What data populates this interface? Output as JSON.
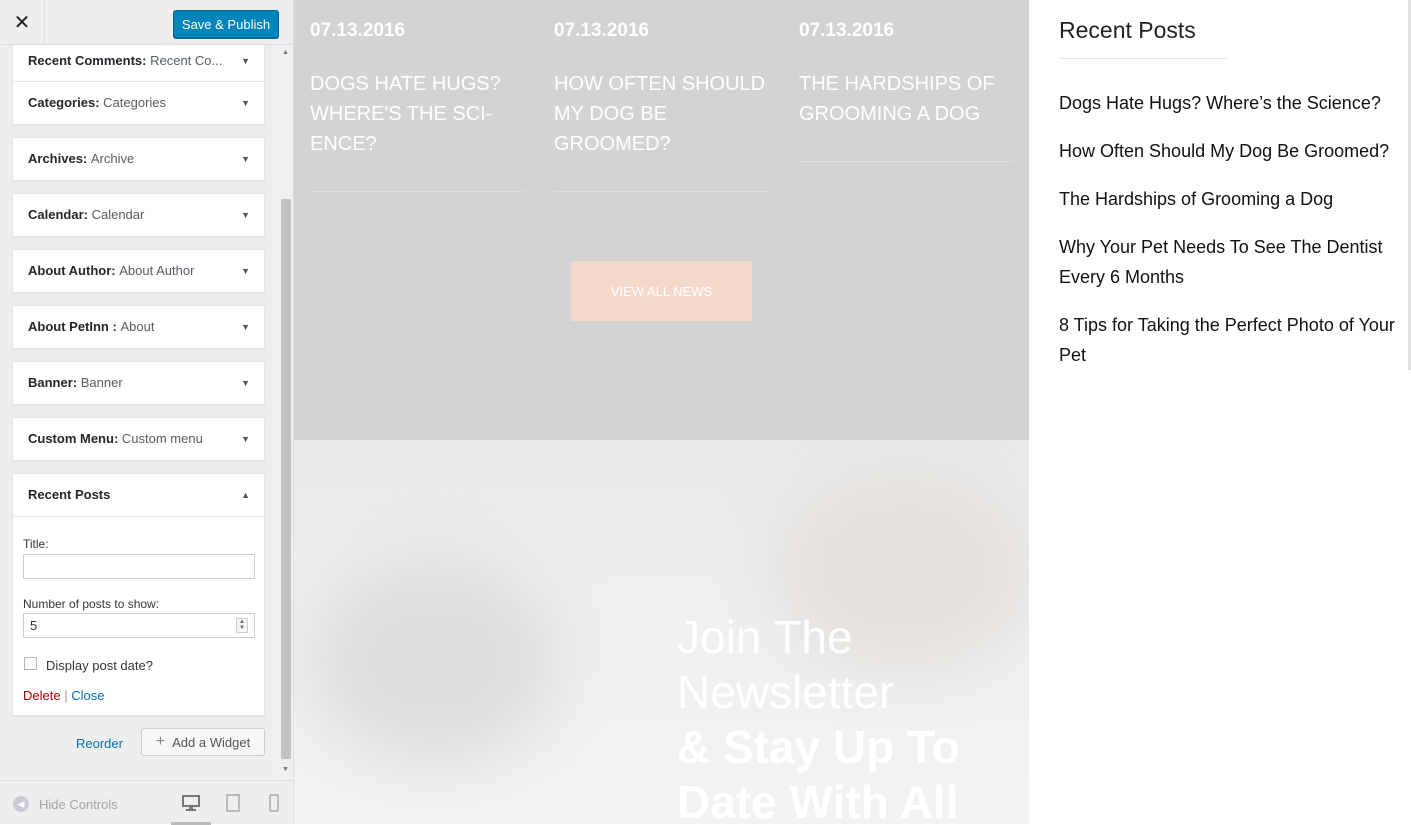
{
  "customizer": {
    "close_icon": "close-icon",
    "publish_label": "Save & Publish",
    "widgets": [
      {
        "name": "Recent Comments",
        "sub": "Recent Co..."
      },
      {
        "name": "Categories",
        "sub": "Categories"
      },
      {
        "name": "Archives",
        "sub": "Archive"
      },
      {
        "name": "Calendar",
        "sub": "Calendar"
      },
      {
        "name": "About Author",
        "sub": "About Author"
      },
      {
        "name": "About PetInn ",
        "sub": "About"
      },
      {
        "name": "Banner",
        "sub": "Banner"
      },
      {
        "name": "Custom Menu",
        "sub": "Custom menu"
      }
    ],
    "open_widget": {
      "name": "Recent Posts",
      "title_label": "Title:",
      "title_value": "",
      "number_label": "Number of posts to show:",
      "number_value": "5",
      "display_date_label": "Display post date?",
      "display_date_checked": false,
      "delete_label": "Delete",
      "separator": "|",
      "close_label": "Close"
    },
    "reorder_label": "Reorder",
    "add_widget_label": "Add a Widget",
    "hide_controls_label": "Hide Controls",
    "accent_color": "#0085ba"
  },
  "preview": {
    "news": [
      {
        "date": "07.13.2016",
        "title": "Dogs Hate Hugs? Where's the Sci- ence?"
      },
      {
        "date": "07.13.2016",
        "title": "How Often Should My Dog Be Groomed?"
      },
      {
        "date": "07.13.2016",
        "title": "The Hardships of Grooming a Dog"
      }
    ],
    "view_all_label": "View All News",
    "newsletter": {
      "line1": "Join The",
      "line2": "Newsletter",
      "line3": "& Stay Up To",
      "line4": "Date With All"
    },
    "button_color": "#f4d8ca"
  },
  "sidebar": {
    "title": "Recent Posts",
    "posts": [
      "Dogs Hate Hugs? Where’s the Science?",
      "How Often Should My Dog Be Groomed?",
      "The Hardships of Grooming a Dog",
      "Why Your Pet Needs To See The Dentist Every 6 Months",
      "8 Tips for Taking the Perfect Photo of Your Pet"
    ]
  }
}
